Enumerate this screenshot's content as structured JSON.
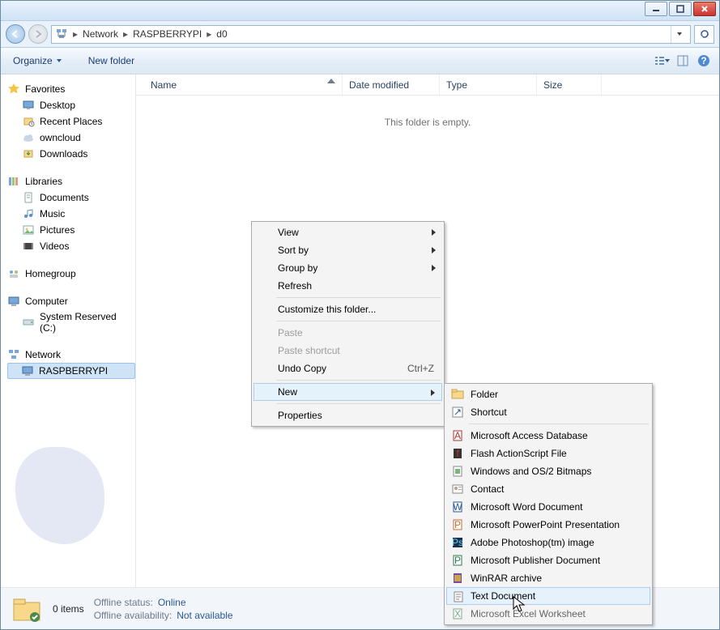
{
  "breadcrumb": {
    "items": [
      "Network",
      "RASPBERRYPI",
      "d0"
    ]
  },
  "toolbar": {
    "organize": "Organize",
    "newfolder": "New folder"
  },
  "columns": {
    "name": "Name",
    "date": "Date modified",
    "type": "Type",
    "size": "Size"
  },
  "empty_msg": "This folder is empty.",
  "sidebar": {
    "favorites": {
      "label": "Favorites",
      "items": [
        "Desktop",
        "Recent Places",
        "owncloud",
        "Downloads"
      ]
    },
    "libraries": {
      "label": "Libraries",
      "items": [
        "Documents",
        "Music",
        "Pictures",
        "Videos"
      ]
    },
    "homegroup": {
      "label": "Homegroup"
    },
    "computer": {
      "label": "Computer",
      "items": [
        "System Reserved (C:)"
      ]
    },
    "network": {
      "label": "Network",
      "items": [
        "RASPBERRYPI"
      ]
    }
  },
  "ctx1": {
    "view": "View",
    "sort": "Sort by",
    "group": "Group by",
    "refresh": "Refresh",
    "customize": "Customize this folder...",
    "paste": "Paste",
    "paste_sc": "Paste shortcut",
    "undo": "Undo Copy",
    "undo_sc": "Ctrl+Z",
    "new": "New",
    "props": "Properties"
  },
  "ctx2": {
    "items": [
      "Folder",
      "Shortcut",
      "Microsoft Access Database",
      "Flash ActionScript File",
      "Windows and OS/2 Bitmaps",
      "Contact",
      "Microsoft Word Document",
      "Microsoft PowerPoint Presentation",
      "Adobe Photoshop(tm) image",
      "Microsoft Publisher Document",
      "WinRAR archive",
      "Text Document",
      "Microsoft Excel Worksheet"
    ]
  },
  "status": {
    "count": "0 items",
    "offline_status_label": "Offline status:",
    "offline_status_value": "Online",
    "offline_avail_label": "Offline availability:",
    "offline_avail_value": "Not available"
  }
}
